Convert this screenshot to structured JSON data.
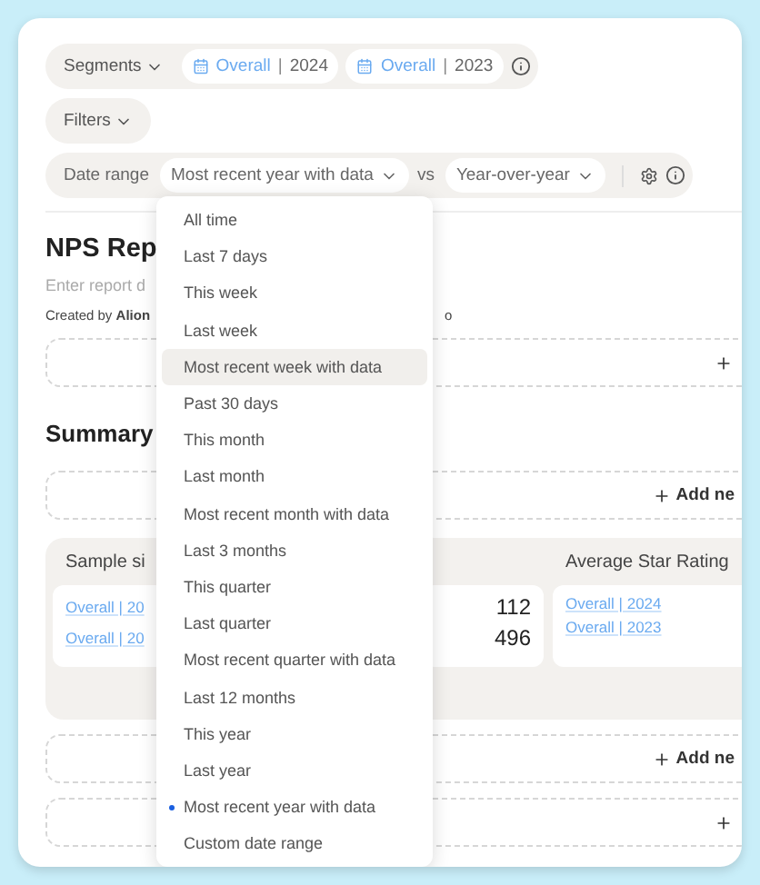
{
  "segments": {
    "label": "Segments",
    "chips": [
      {
        "name": "Overall",
        "separator": "|",
        "year": "2024"
      },
      {
        "name": "Overall",
        "separator": "|",
        "year": "2023"
      }
    ]
  },
  "filters": {
    "label": "Filters"
  },
  "date_range": {
    "label": "Date range",
    "value": "Most recent year with data",
    "vs": "vs",
    "comparison": "Year-over-year"
  },
  "dropdown": {
    "items": [
      {
        "label": "All time",
        "selected": false,
        "hovered": false
      },
      {
        "label": "Last 7 days",
        "selected": false,
        "hovered": false
      },
      {
        "label": "This week",
        "selected": false,
        "hovered": false
      },
      {
        "label": "Last week",
        "selected": false,
        "hovered": false
      },
      {
        "label": "Most recent week with data",
        "selected": false,
        "hovered": true
      },
      {
        "label": "Past 30 days",
        "selected": false,
        "hovered": false
      },
      {
        "label": "This month",
        "selected": false,
        "hovered": false
      },
      {
        "label": "Last month",
        "selected": false,
        "hovered": false
      },
      {
        "label": "Most recent month with data",
        "selected": false,
        "hovered": false
      },
      {
        "label": "Last 3 months",
        "selected": false,
        "hovered": false
      },
      {
        "label": "This quarter",
        "selected": false,
        "hovered": false
      },
      {
        "label": "Last quarter",
        "selected": false,
        "hovered": false
      },
      {
        "label": "Most recent quarter with data",
        "selected": false,
        "hovered": false
      },
      {
        "label": "Last 12 months",
        "selected": false,
        "hovered": false
      },
      {
        "label": "This year",
        "selected": false,
        "hovered": false
      },
      {
        "label": "Last year",
        "selected": false,
        "hovered": false
      },
      {
        "label": "Most recent year with data",
        "selected": true,
        "hovered": false
      },
      {
        "label": "Custom date range",
        "selected": false,
        "hovered": false
      }
    ]
  },
  "report": {
    "title": "NPS Rep",
    "description_placeholder": "Enter report d",
    "created_by": "Created by **Alion**",
    "meta_tail": "o"
  },
  "sections": [
    {
      "kind": "add"
    },
    {
      "kind": "heading",
      "text": "Summary"
    },
    {
      "kind": "add",
      "label": "Add ne"
    },
    {
      "kind": "metrics",
      "cards": [
        {
          "title": "Sample si",
          "rows": [
            {
              "segment": "Overall | 20",
              "value": "112"
            },
            {
              "segment": "Overall | 20",
              "value": "496"
            }
          ]
        },
        {
          "title": "Average Star Rating",
          "rows": [
            {
              "segment": "Overall | 2024"
            },
            {
              "segment": "Overall | 2023"
            }
          ]
        }
      ]
    },
    {
      "kind": "add",
      "label": "Add ne"
    },
    {
      "kind": "add"
    }
  ]
}
